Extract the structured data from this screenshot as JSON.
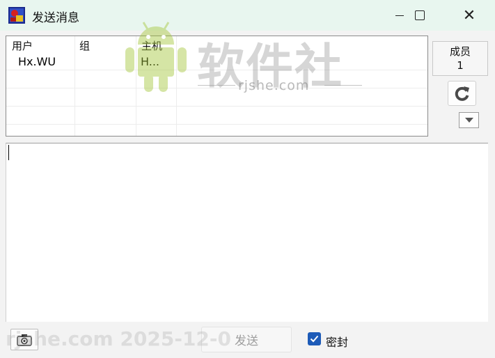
{
  "window": {
    "title": "发送消息",
    "icons": {
      "app": "app-icon",
      "minimize": "minimize-icon",
      "maximize": "maximize-icon",
      "close": "close-icon"
    },
    "close_glyph": "✕"
  },
  "user_list": {
    "columns": [
      "用户",
      "组",
      "主机"
    ],
    "rows": [
      {
        "user": "Hx.WU",
        "group": "",
        "host": "H..."
      }
    ]
  },
  "members": {
    "label": "成员",
    "count": "1"
  },
  "toolbar": {
    "refresh_icon": "refresh-icon",
    "dropdown_icon": "dropdown-arrow-icon"
  },
  "message": {
    "value": ""
  },
  "footer": {
    "capture_icon": "camera-icon",
    "send_label": "发送",
    "seal_label": "密封",
    "seal_checked": true
  },
  "watermark": {
    "brand": "软件社",
    "domain": "rjshe.com",
    "bottom": "rjshe.com 2025-12-0"
  },
  "colors": {
    "titlebar": "#e8f6ef",
    "checkbox": "#1d5bb8",
    "android_green": "#a4c639"
  }
}
